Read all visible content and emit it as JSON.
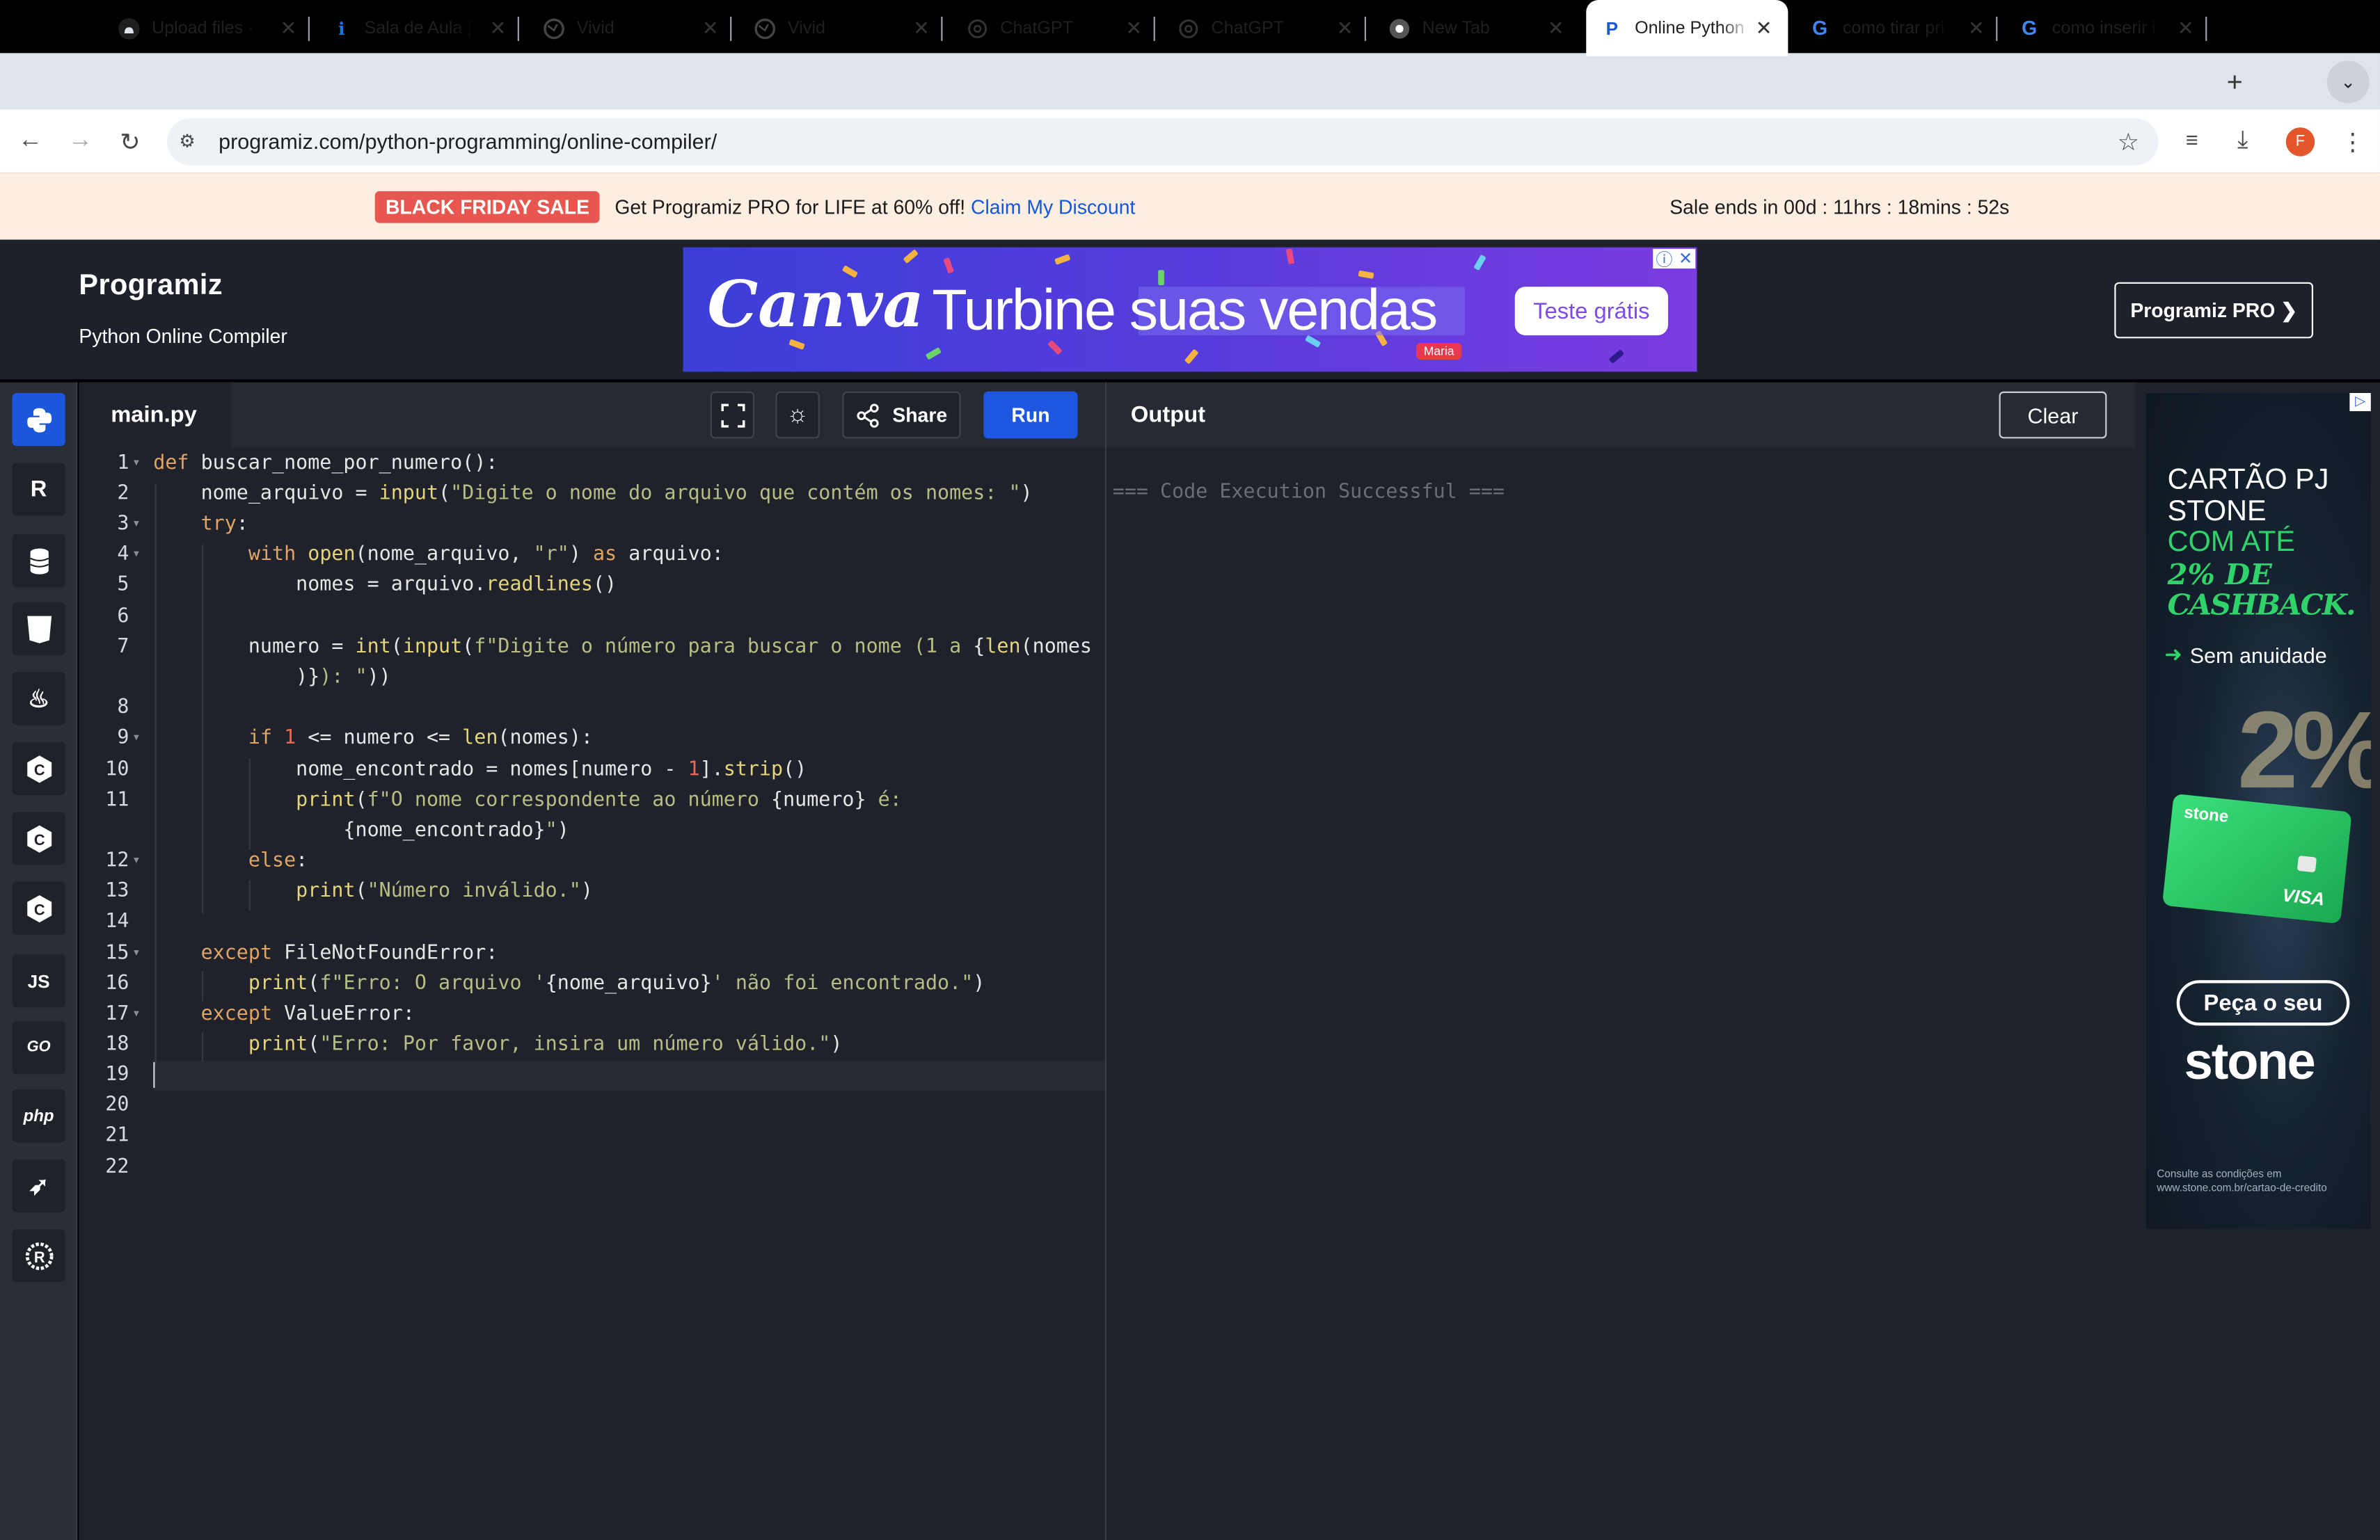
{
  "browser": {
    "tabs": [
      {
        "title": "Upload files · ",
        "favicon": "github-icon"
      },
      {
        "title": "Sala de Aula | ",
        "favicon": "info-icon"
      },
      {
        "title": "Vivid",
        "favicon": "globe-icon"
      },
      {
        "title": "Vivid",
        "favicon": "globe-icon"
      },
      {
        "title": "ChatGPT",
        "favicon": "chatgpt-icon"
      },
      {
        "title": "ChatGPT",
        "favicon": "chatgpt-icon"
      },
      {
        "title": "New Tab",
        "favicon": "chrome-icon"
      },
      {
        "title": "Online Python",
        "favicon": "programiz-icon",
        "active": true
      },
      {
        "title": "como tirar pri",
        "favicon": "google-icon"
      },
      {
        "title": "como inserir i",
        "favicon": "google-icon"
      }
    ],
    "url": "programiz.com/python-programming/online-compiler/",
    "profile_initial": "F"
  },
  "promo": {
    "badge": "BLACK FRIDAY SALE",
    "text": "Get Programiz PRO for LIFE at 60% off!",
    "link": "Claim My Discount",
    "timer": "Sale ends in 00d : 11hrs : 18mins : 52s"
  },
  "header": {
    "logo": "Programiz",
    "subtitle": "Python Online Compiler",
    "pro_button": "Programiz PRO ❯"
  },
  "ad_top": {
    "brand": "Canva",
    "headline": "Turbine suas vendas",
    "tag": "Maria",
    "cta": "Teste grátis"
  },
  "sidebar": {
    "languages": [
      {
        "name": "python-icon",
        "label": ""
      },
      {
        "name": "r-icon",
        "label": "R"
      },
      {
        "name": "sql-icon",
        "label": ""
      },
      {
        "name": "html-icon",
        "label": "5"
      },
      {
        "name": "java-icon",
        "label": ""
      },
      {
        "name": "c-icon",
        "label": "C"
      },
      {
        "name": "cplusplus-icon",
        "label": "C"
      },
      {
        "name": "csharp-icon",
        "label": "C"
      },
      {
        "name": "javascript-icon",
        "label": "JS"
      },
      {
        "name": "go-icon",
        "label": "GO"
      },
      {
        "name": "php-icon",
        "label": "php"
      },
      {
        "name": "swift-icon",
        "label": ""
      },
      {
        "name": "rust-icon",
        "label": "R"
      }
    ]
  },
  "editor": {
    "filename": "main.py",
    "share": "Share",
    "run": "Run",
    "line_numbers": [
      "1",
      "2",
      "3",
      "4",
      "5",
      "6",
      "7",
      "8",
      "9",
      "10",
      "11",
      "12",
      "13",
      "14",
      "15",
      "16",
      "17",
      "18",
      "19",
      "20",
      "21",
      "22"
    ]
  },
  "output": {
    "title": "Output",
    "clear": "Clear",
    "text": "=== Code Execution Successful ==="
  },
  "ad_right": {
    "line1": "CARTÃO PJ",
    "line2": "STONE",
    "line3": "COM ATÉ",
    "line4": "2% DE",
    "line5": "CASHBACK.",
    "feature": "Sem anuidade",
    "card_brand": "stone",
    "card_network": "VISA",
    "cta": "Peça o seu",
    "brand": "stone",
    "fine_print_1": "Consulte as condições em",
    "fine_print_2": "www.stone.com.br/cartao-de-credito"
  },
  "colors": {
    "run_button": "#1d56e1",
    "editor_bg": "#1f222b",
    "promo_bg": "#fdeee2",
    "badge": "#e8574f"
  }
}
